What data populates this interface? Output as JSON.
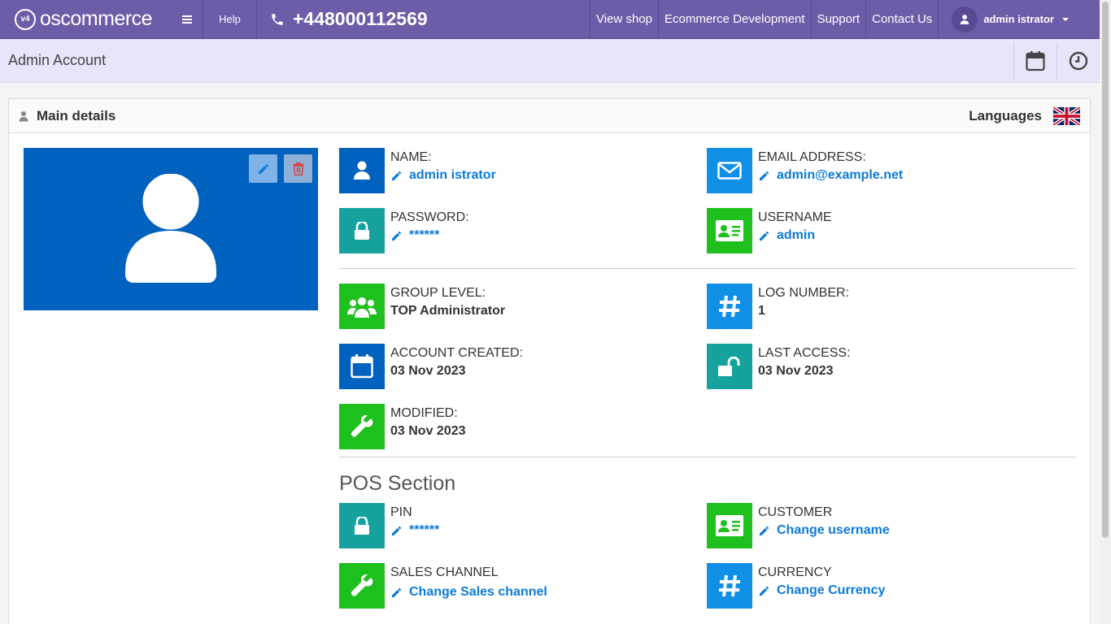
{
  "topbar": {
    "logo_text": "oscommerce",
    "logo_badge": "v4",
    "help_label": "Help",
    "phone": "+448000112569",
    "links": [
      "View shop",
      "Ecommerce Development",
      "Support",
      "Contact Us"
    ],
    "user_name": "admin istrator"
  },
  "page": {
    "title": "Admin Account"
  },
  "panel": {
    "title": "Main details",
    "languages_label": "Languages"
  },
  "fields": {
    "name": {
      "label": "NAME:",
      "value": "admin istrator"
    },
    "email": {
      "label": "EMAIL ADDRESS:",
      "value": "admin@example.net"
    },
    "password": {
      "label": "PASSWORD:",
      "value": "******"
    },
    "username": {
      "label": "USERNAME",
      "value": "admin"
    },
    "group": {
      "label": "GROUP LEVEL:",
      "value": "TOP Administrator"
    },
    "log": {
      "label": "LOG NUMBER:",
      "value": "1"
    },
    "created": {
      "label": "ACCOUNT CREATED:",
      "value": "03 Nov 2023"
    },
    "last_access": {
      "label": "LAST ACCESS:",
      "value": "03 Nov 2023"
    },
    "modified": {
      "label": "MODIFIED:",
      "value": "03 Nov 2023"
    }
  },
  "pos": {
    "title": "POS Section",
    "pin": {
      "label": "PIN",
      "value": "******"
    },
    "customer": {
      "label": "CUSTOMER",
      "value": "Change username"
    },
    "channel": {
      "label": "SALES CHANNEL",
      "value": "Change Sales channel"
    },
    "currency": {
      "label": "CURRENCY",
      "value": "Change Currency"
    }
  },
  "colors": {
    "topbar": "#6d5ca7",
    "subbar": "#e8e4fa",
    "dark_blue": "#0161bf",
    "light_blue": "#0f8fe6",
    "teal": "#16a3a0",
    "green": "#1ec01e",
    "link": "#0c7ad8"
  }
}
